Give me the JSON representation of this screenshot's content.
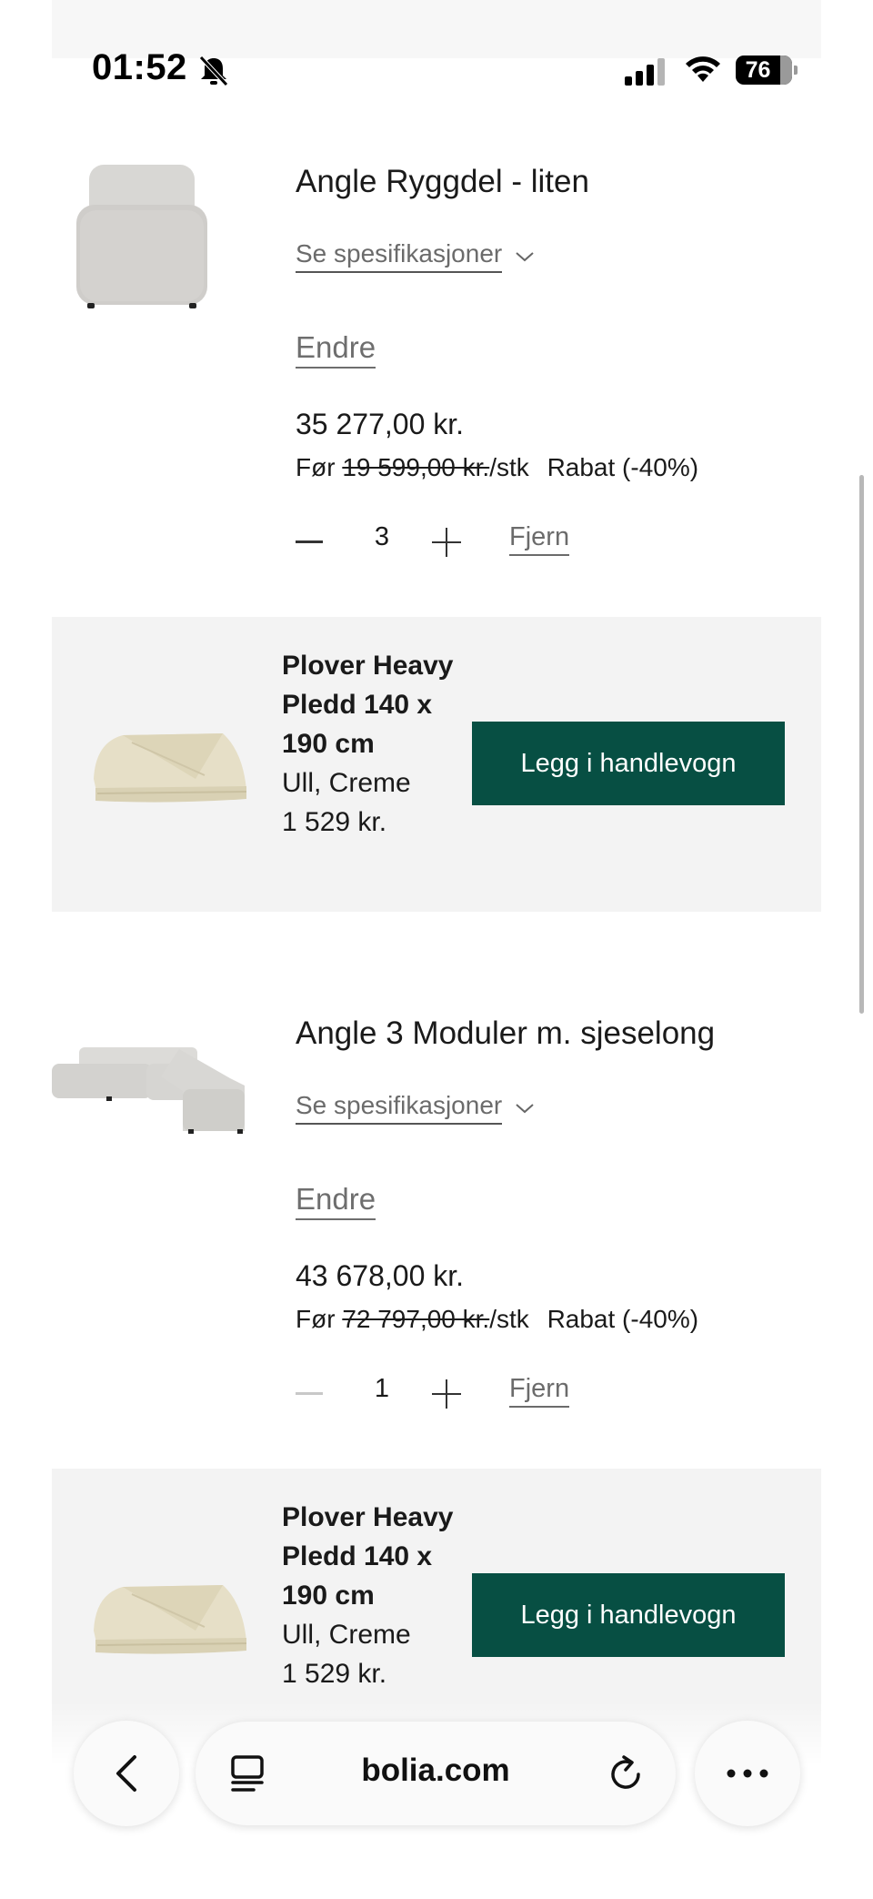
{
  "status_bar": {
    "time": "01:52",
    "battery": "76"
  },
  "products": [
    {
      "title": "Angle Ryggdel - liten",
      "specs_label": "Se spesifikasjoner",
      "edit_label": "Endre",
      "price": "35 277,00 kr.",
      "before_prefix": "Før",
      "before_price": "19 599,00 kr.",
      "per_unit": "/stk",
      "discount": "Rabat (-40%)",
      "quantity": "3",
      "remove_label": "Fjern"
    },
    {
      "title": "Angle 3 Moduler m. sjeselong",
      "specs_label": "Se spesifikasjoner",
      "edit_label": "Endre",
      "price": "43 678,00 kr.",
      "before_prefix": "Før",
      "before_price": "72 797,00 kr.",
      "per_unit": "/stk",
      "discount": "Rabat (-40%)",
      "quantity": "1",
      "remove_label": "Fjern"
    }
  ],
  "upsells": [
    {
      "name": "Plover Heavy Pledd 140 x 190 cm",
      "variant": "Ull, Creme",
      "price": "1 529 kr.",
      "button": "Legg i handlevogn"
    },
    {
      "name": "Plover Heavy Pledd 140 x 190 cm",
      "variant": "Ull, Creme",
      "price": "1 529 kr.",
      "button": "Legg i handlevogn"
    }
  ],
  "browser": {
    "url": "bolia.com"
  },
  "colors": {
    "accent": "#074f43",
    "upsell_bg": "#f3f3f3"
  }
}
